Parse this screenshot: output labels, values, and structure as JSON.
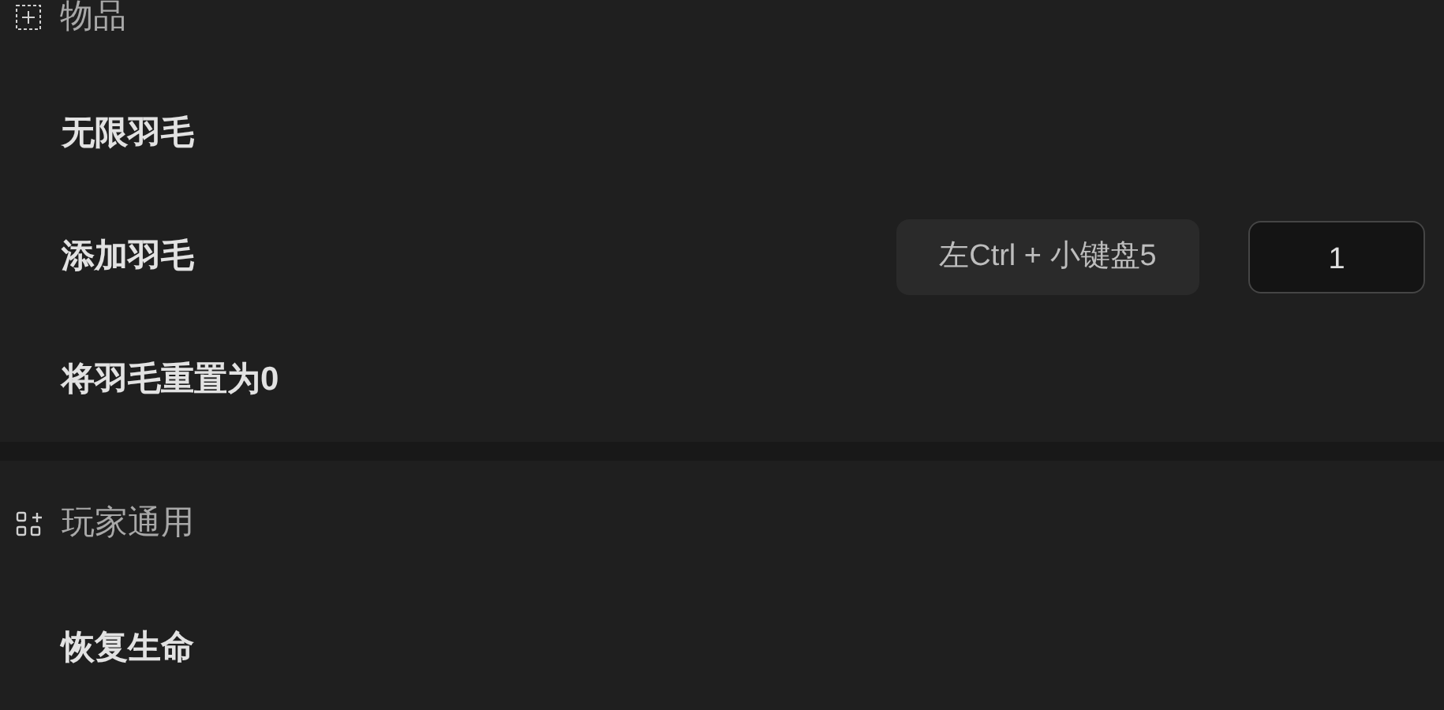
{
  "sections": [
    {
      "title": "物品",
      "items": [
        {
          "label": "无限羽毛",
          "kind": "plain"
        },
        {
          "label": "添加羽毛",
          "kind": "hotkey-input",
          "hotkey": "左Ctrl + 小键盘5",
          "value": "1"
        },
        {
          "label": "将羽毛重置为0",
          "kind": "plain"
        }
      ]
    },
    {
      "title": "玩家通用",
      "items": [
        {
          "label": "恢复生命",
          "kind": "plain"
        }
      ]
    }
  ]
}
